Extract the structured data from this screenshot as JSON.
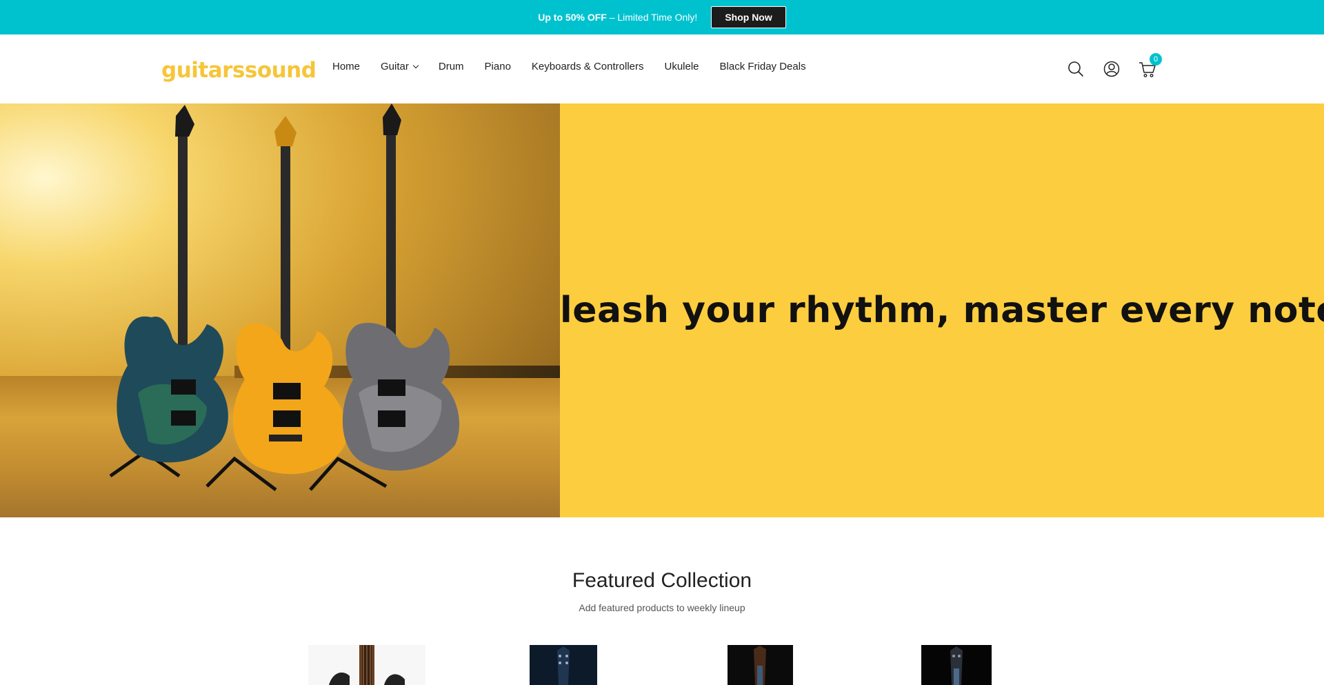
{
  "announcement": {
    "bold_text": "Up to 50% OFF",
    "text": " – Limited Time Only!",
    "button_label": "Shop Now",
    "background_color": "#00c2cf"
  },
  "header": {
    "logo": "guitarssound",
    "logo_color": "#f6c538",
    "nav": [
      {
        "label": "Home"
      },
      {
        "label": "Guitar",
        "has_dropdown": true
      },
      {
        "label": "Drum"
      },
      {
        "label": "Piano"
      },
      {
        "label": "Keyboards & Controllers"
      },
      {
        "label": "Ukulele"
      },
      {
        "label": "Black Friday Deals"
      }
    ],
    "icons": [
      "search-icon",
      "account-icon",
      "cart-icon"
    ],
    "cart_count": "0"
  },
  "hero": {
    "headline": "Unleash your rhythm, master every note.",
    "image_subject": "three-electric-guitars-on-stands",
    "panel_color": "#fccd3e"
  },
  "featured": {
    "title": "Featured Collection",
    "subtitle": "Add featured products to weekly lineup",
    "products": [
      {
        "image": "guitar-body-white-background"
      },
      {
        "image": "guitar-headstock-dark-blue"
      },
      {
        "image": "guitar-headstock-dark-wood"
      },
      {
        "image": "guitar-headstock-dark-grey"
      }
    ]
  }
}
